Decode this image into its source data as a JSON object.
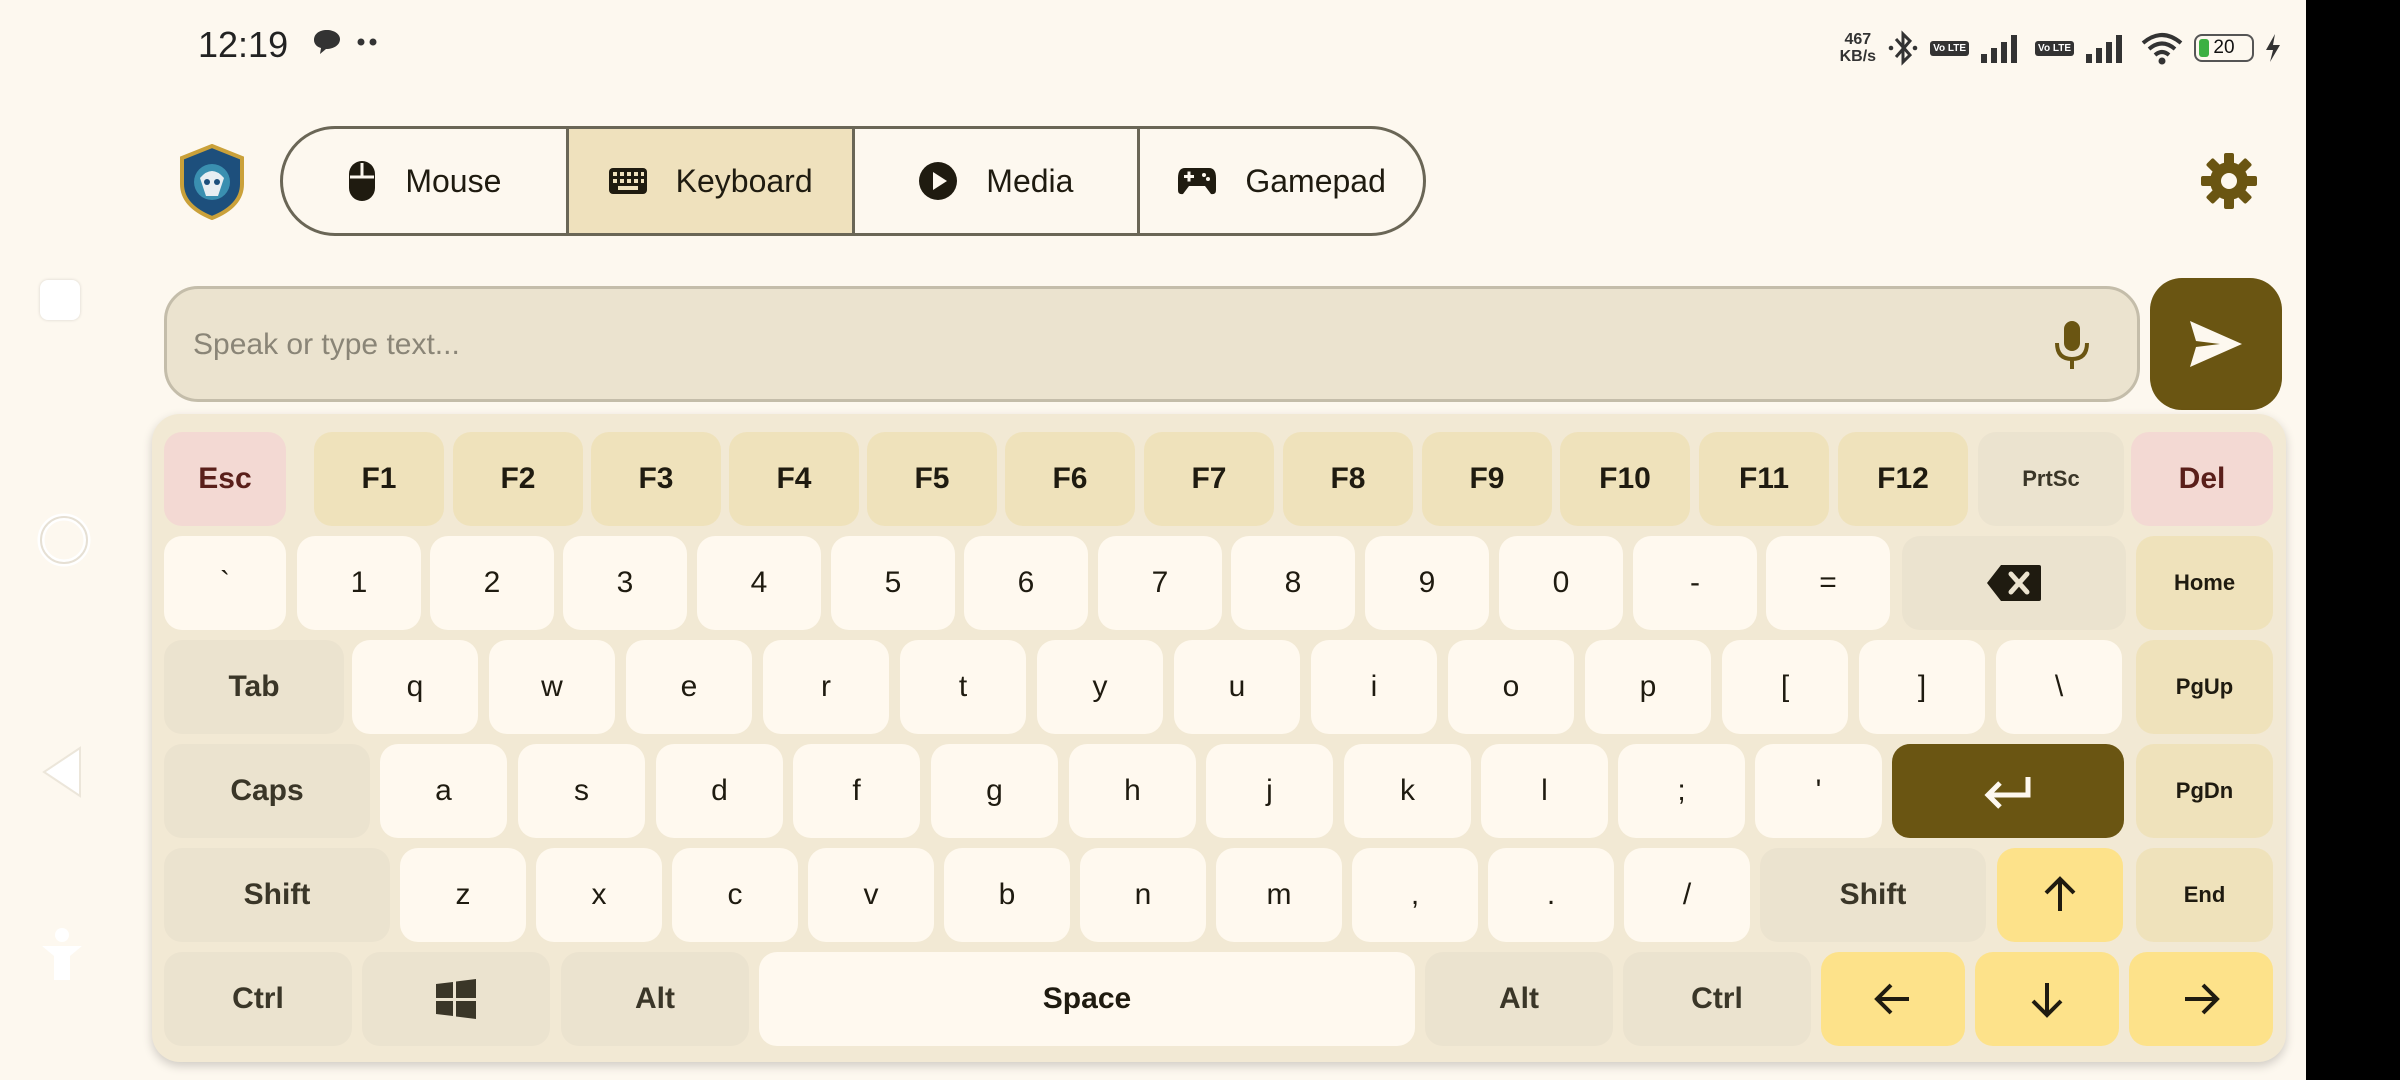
{
  "status_bar": {
    "time": "12:19",
    "net_speed_value": "467",
    "net_speed_unit": "KB/s",
    "volte1": "Vo LTE",
    "volte2": "Vo LTE",
    "battery_level": "20",
    "battery_fraction": 0.2,
    "icons": [
      "chat-bubble-icon",
      "more-dots-icon",
      "bluetooth-icon",
      "signal-icon",
      "wifi-icon",
      "charging-icon"
    ]
  },
  "nav": {
    "icons": [
      "recents-icon",
      "home-icon",
      "back-icon",
      "accessibility-icon"
    ]
  },
  "mode_tabs": [
    {
      "label": "Mouse",
      "icon": "mouse-icon",
      "active": false
    },
    {
      "label": "Keyboard",
      "icon": "keyboard-icon",
      "active": true
    },
    {
      "label": "Media",
      "icon": "play-icon",
      "active": false
    },
    {
      "label": "Gamepad",
      "icon": "gamepad-icon",
      "active": false
    }
  ],
  "input": {
    "placeholder": "Speak or type text...",
    "value": ""
  },
  "keyboard": {
    "row1": [
      "Esc",
      "F1",
      "F2",
      "F3",
      "F4",
      "F5",
      "F6",
      "F7",
      "F8",
      "F9",
      "F10",
      "F11",
      "F12",
      "PrtSc",
      "Del"
    ],
    "row2": [
      "`",
      "1",
      "2",
      "3",
      "4",
      "5",
      "6",
      "7",
      "8",
      "9",
      "0",
      "-",
      "=",
      "Home"
    ],
    "row3": [
      "Tab",
      "q",
      "w",
      "e",
      "r",
      "t",
      "y",
      "u",
      "i",
      "o",
      "p",
      "[",
      "]",
      "\\",
      "PgUp"
    ],
    "row4": [
      "Caps",
      "a",
      "s",
      "d",
      "f",
      "g",
      "h",
      "j",
      "k",
      "l",
      ";",
      "'",
      "PgDn"
    ],
    "row5": [
      "Shift",
      "z",
      "x",
      "c",
      "v",
      "b",
      "n",
      "m",
      ",",
      ".",
      "/",
      "Shift",
      "End"
    ],
    "row6": [
      "Ctrl",
      "Alt",
      "Space",
      "Alt",
      "Ctrl"
    ]
  },
  "colors": {
    "accent": "#6a5512",
    "background": "#fdf8ef",
    "active_tab": "#efe1bd",
    "arrow_key": "#fde28a",
    "function_key": "#efe2bb",
    "danger_key": "#f3d9d3"
  }
}
